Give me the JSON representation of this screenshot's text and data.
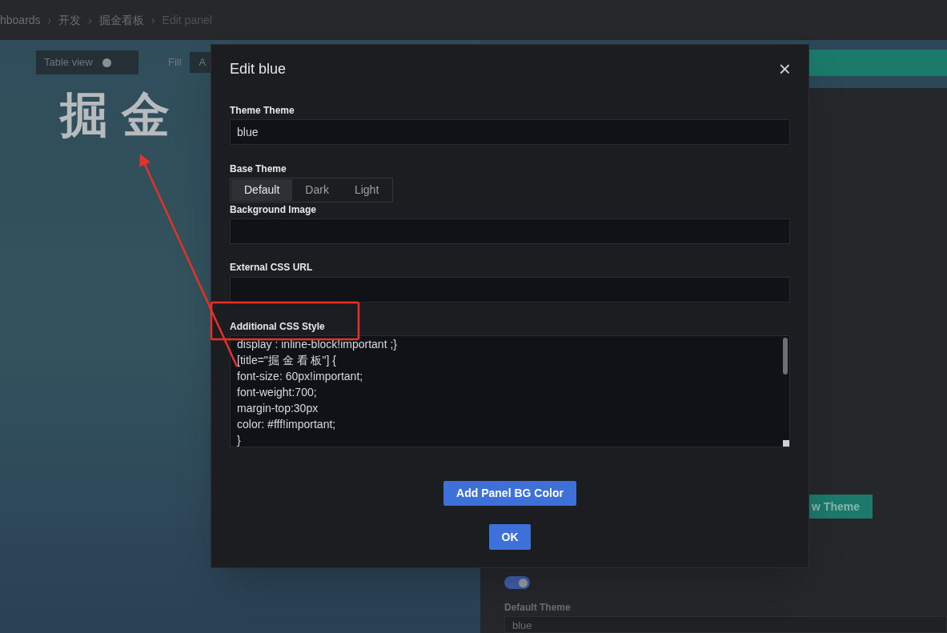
{
  "breadcrumbs": [
    {
      "label": "hboards"
    },
    {
      "separator": "›",
      "label": "开发"
    },
    {
      "separator": "›",
      "label": "掘金看板"
    },
    {
      "separator": "›",
      "label": "Edit panel"
    }
  ],
  "background_panel": {
    "table_view": {
      "label": "Table view",
      "on": false
    },
    "fill_label": "Fill",
    "cut_button": "A",
    "title": "掘 金"
  },
  "side_panel": {
    "theme_button": "w Theme",
    "toggle": {
      "on": true
    },
    "default_theme": {
      "label": "Default Theme",
      "value": "blue"
    }
  },
  "dialog": {
    "title": "Edit blue",
    "close": "×",
    "theme_name": {
      "label": "Theme Theme",
      "value": "blue"
    },
    "base_theme": {
      "label": "Base Theme",
      "options": [
        {
          "label": "Default",
          "selected": true
        },
        {
          "label": "Dark",
          "selected": false
        },
        {
          "label": "Light",
          "selected": false
        }
      ]
    },
    "background_image": {
      "label": "Background Image"
    },
    "external_css_url": {
      "label": "External CSS URL"
    },
    "additional_css": {
      "label": "Additional CSS Style",
      "lines": [
        "display : inline-block!important ;}",
        "[title=\"掘 金 看 板\"] {",
        "font-size: 60px!important;",
        "font-weight:700;",
        "margin-top:30px",
        "color: #fff!important;",
        "}"
      ]
    },
    "add_button": "Add Panel BG Color",
    "ok_button": "OK"
  }
}
